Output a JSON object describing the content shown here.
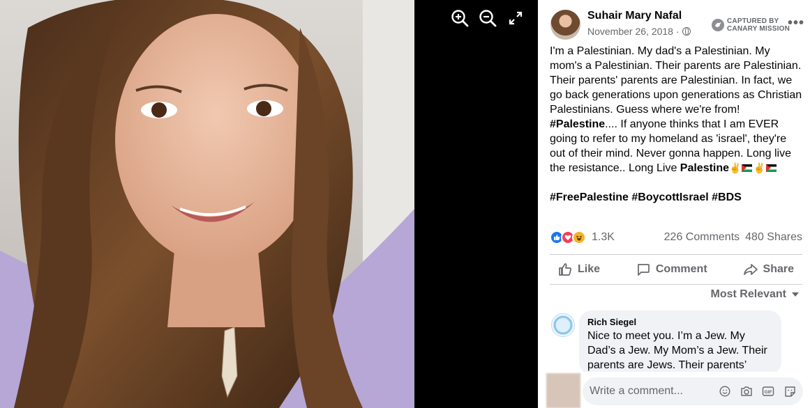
{
  "viewer": {
    "tools": [
      "zoom-in",
      "zoom-out",
      "fullscreen"
    ]
  },
  "post": {
    "author": "Suhair Mary Nafal",
    "date": "November 26, 2018",
    "date_separator": "·",
    "captured": {
      "line1": "CAPTURED BY",
      "line2": "CANARY MISSION"
    },
    "more": "•••",
    "body_segments": [
      {
        "text": "I'm a Palestinian. My dad's a Palestinian. My mom's a Palestinian. Their parents are Palestinian. Their parents' parents are Palestinian. In fact, we go back generations upon generations as Christian Palestinians. Guess where we're from! ",
        "bold": false
      },
      {
        "text": "#Palestine",
        "bold": true
      },
      {
        "text": ".... If anyone thinks that I am EVER going to refer to my homeland as 'israel', they're out of their mind. Never gonna happen. Long live the resistance.. Long Live ",
        "bold": false
      },
      {
        "text": "Palestine",
        "bold": true
      }
    ],
    "emoji_tail": [
      "✌",
      "flag",
      "✌",
      "flag"
    ],
    "hashtags": "#FreePalestine #BoycottIsrael #BDS",
    "reaction_count": "1.3K",
    "comments_count": "226 Comments",
    "shares_count": "480 Shares",
    "actions": {
      "like": "Like",
      "comment": "Comment",
      "share": "Share"
    },
    "sort_label": "Most Relevant"
  },
  "comment": {
    "author": "Rich Siegel",
    "text": "Nice to meet you. I’m a Jew. My Dad’s a Jew. My Mom’s a Jew. Their parents are Jews. Their parents’"
  },
  "composer": {
    "placeholder": "Write a comment..."
  },
  "colors": {
    "accent": "#1877f2",
    "secondary_text": "#65676b",
    "bubble_bg": "#f0f2f5"
  }
}
